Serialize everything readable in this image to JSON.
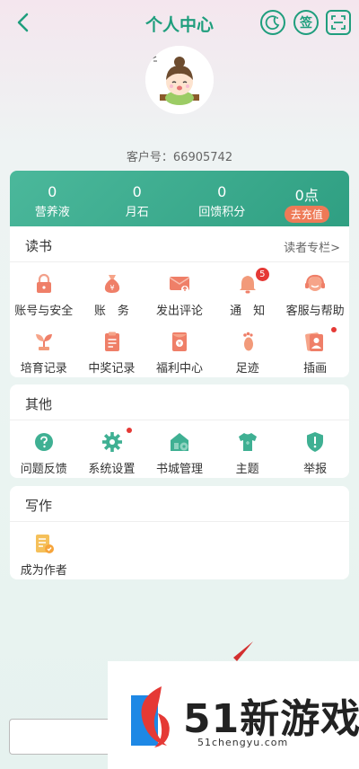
{
  "header": {
    "title": "个人中心",
    "sign_label": "签"
  },
  "user": {
    "customer_label": "客户号：",
    "customer_id": "66905742"
  },
  "stats": [
    {
      "value": "0",
      "label": "营养液"
    },
    {
      "value": "0",
      "label": "月石"
    },
    {
      "value": "0",
      "label": "回馈积分"
    },
    {
      "value": "0点",
      "label": "去充值"
    }
  ],
  "reading": {
    "title": "读书",
    "link": "读者专栏>",
    "items": [
      {
        "label": "账号与安全",
        "icon": "lock-icon"
      },
      {
        "label": "账　务",
        "icon": "money-bag-icon"
      },
      {
        "label": "发出评论",
        "icon": "comment-mail-icon"
      },
      {
        "label": "通　知",
        "icon": "bell-icon",
        "badge": "5"
      },
      {
        "label": "客服与帮助",
        "icon": "customer-service-icon"
      },
      {
        "label": "培育记录",
        "icon": "sprout-icon"
      },
      {
        "label": "中奖记录",
        "icon": "clipboard-icon"
      },
      {
        "label": "福利中心",
        "icon": "red-envelope-icon"
      },
      {
        "label": "足迹",
        "icon": "footprint-icon"
      },
      {
        "label": "插画",
        "icon": "illustration-icon"
      }
    ]
  },
  "other": {
    "title": "其他",
    "items": [
      {
        "label": "问题反馈",
        "icon": "question-icon"
      },
      {
        "label": "系统设置",
        "icon": "gear-icon"
      },
      {
        "label": "书城管理",
        "icon": "bookstore-icon"
      },
      {
        "label": "主题",
        "icon": "shirt-icon"
      },
      {
        "label": "举报",
        "icon": "report-shield-icon"
      }
    ]
  },
  "writing": {
    "title": "写作",
    "items": [
      {
        "label": "成为作者",
        "icon": "author-icon"
      }
    ]
  },
  "ad": {
    "name": "51新游戏",
    "url": "51chengyu.com"
  },
  "colors": {
    "accent": "#1f9e7d",
    "stats_bg": "#3aa98c",
    "recharge": "#ee7a57",
    "badge": "#e53935"
  }
}
